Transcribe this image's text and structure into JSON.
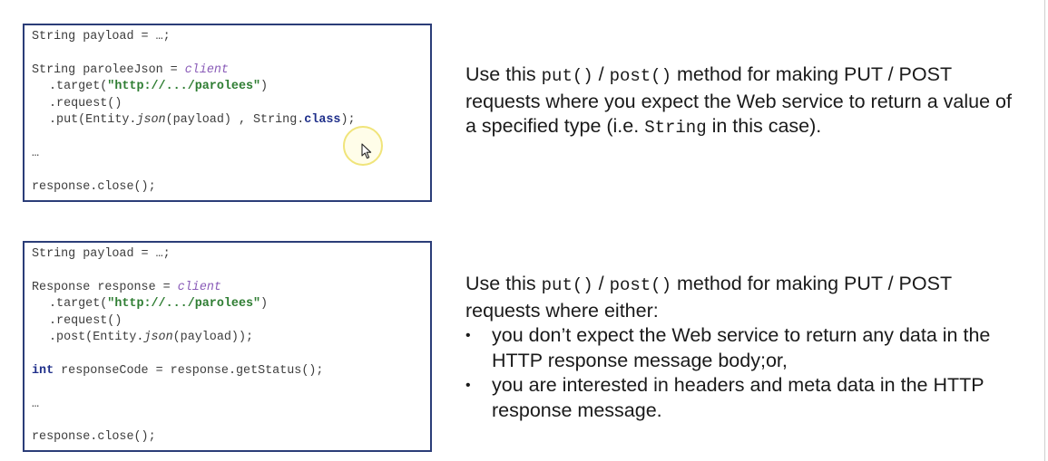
{
  "top_example": {
    "code_lines": [
      "String payload = …;",
      "",
      "String paroleeJson = ",
      "client",
      ".target(",
      "\"http://.../parolees\"",
      ")",
      ".request()",
      ".put(Entity.",
      "json",
      "(payload) , String.",
      "class",
      ");",
      "…",
      "response.close();"
    ],
    "description": {
      "p1": "Use this ",
      "put_code": "put()",
      "slash": " / ",
      "post_code": "post()",
      "p2": " method for making PUT / POST requests where you expect the Web service to return a value of a specified type (i.e. ",
      "string_code": "String",
      "p3": " in this case)."
    }
  },
  "bottom_example": {
    "code_lines": [
      "String payload = …;",
      "",
      "Response response = ",
      "client",
      ".target(",
      "\"http://.../parolees\"",
      ")",
      ".request()",
      ".post(Entity.",
      "json",
      "(payload));",
      "int",
      " responseCode = response.getStatus();",
      "…",
      "response.close();"
    ],
    "description": {
      "p1": "Use this ",
      "put_code": "put()",
      "slash": " / ",
      "post_code": "post()",
      "p2": " method for making PUT / POST requests where either:",
      "bullets": [
        "you don’t expect the Web service to return any data in the HTTP response message body;or,",
        "you are interested in headers and meta data in the HTTP response message."
      ],
      "bullet_symbol": "•"
    }
  },
  "colors": {
    "box_border": "#2b3d78",
    "client_keyword": "#8a5cb8",
    "string_literal": "#2e7d32",
    "java_keyword": "#1f2f8a",
    "code_text": "#3c3c3c",
    "cursor_highlight": "#f0e47a"
  },
  "icons": {
    "cursor": "mouse-pointer-icon"
  }
}
